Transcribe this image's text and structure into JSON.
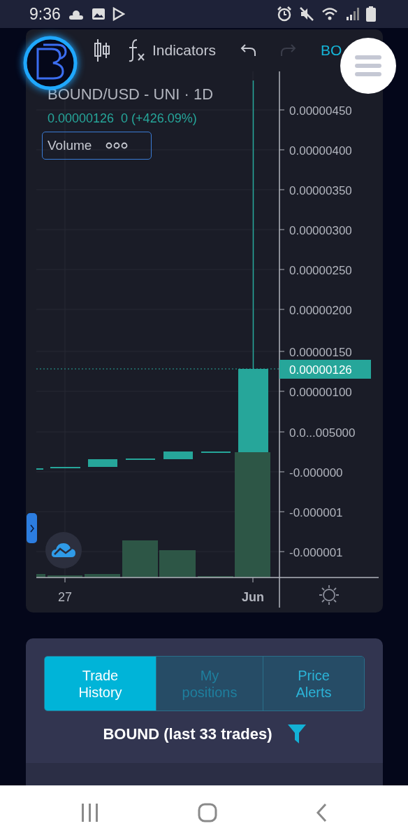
{
  "status_bar": {
    "time": "9:36"
  },
  "toolbar": {
    "items": [
      {
        "kind": "candles"
      },
      {
        "kind": "fx",
        "label": "Indicators"
      },
      {
        "kind": "undo",
        "disabled": false
      },
      {
        "kind": "redo",
        "disabled": true
      },
      {
        "kind": "text",
        "label": "BO"
      }
    ]
  },
  "chart": {
    "title": "BOUND/USD - UNI · 1D",
    "price_line": "0.00000126  0 (+426.09%)",
    "legend": "Volume",
    "y_axis_labels": [
      "0.00000450",
      "0.00000400",
      "0.00000350",
      "0.00000300",
      "0.00000250",
      "0.00000200",
      "0.00000150",
      "0.00000100",
      "0.0...005000",
      "-0.000000",
      "-0.000001",
      "-0.000001"
    ],
    "last_price": "0.00000126",
    "x_axis_labels": [
      {
        "label": "27",
        "bold": false
      },
      {
        "label": "Jun",
        "bold": true
      }
    ]
  },
  "panel": {
    "tabs": [
      {
        "label": "Trade History",
        "selected": true,
        "disabled": false
      },
      {
        "label": "My positions",
        "selected": false,
        "disabled": true
      },
      {
        "label": "Price Alerts",
        "selected": false,
        "disabled": false
      }
    ],
    "heading": "BOUND (last 33 trades)"
  }
}
